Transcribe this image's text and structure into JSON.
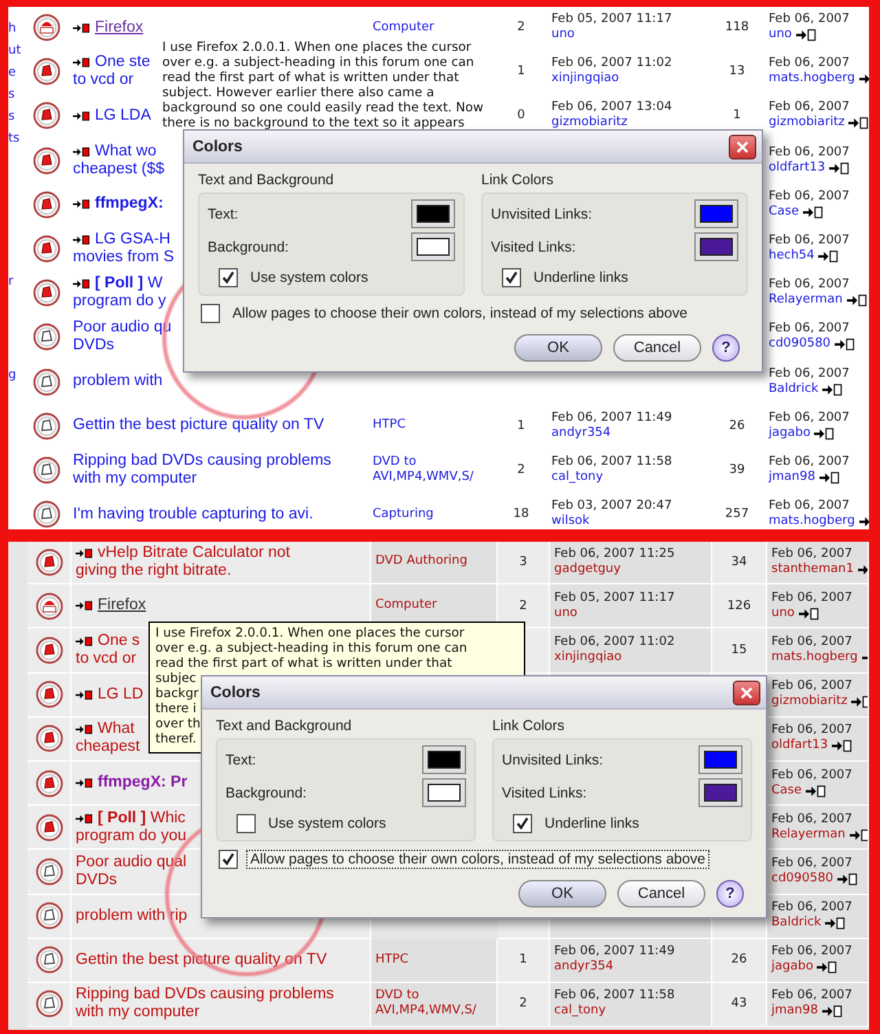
{
  "panels": [
    {
      "kind": "plain",
      "sidebar_fragments": [
        "h",
        "ut",
        "e",
        "s",
        "s",
        "ts",
        "r",
        "g"
      ],
      "rows": [
        {
          "kind": "me",
          "title": "Firefox",
          "visited": true,
          "hovered": true,
          "category": "Computer",
          "replies": "2",
          "last_date": "Feb 05, 2007 11:17",
          "last_name": "uno",
          "views": "118",
          "post_date": "Feb 06, 2007",
          "post_name": "uno"
        },
        {
          "kind": "hot",
          "title": "One ste\nto vcd or",
          "visited": false,
          "hovered": false,
          "replies": "1",
          "last_date": "Feb 06, 2007 11:02",
          "last_name": "xinjingqiao",
          "views": "13",
          "post_date": "Feb 06, 2007",
          "post_name": "mats.hogberg"
        },
        {
          "kind": "hot",
          "title": "LG LDA",
          "visited": false,
          "hovered": false,
          "replies": "0",
          "last_date": "Feb 06, 2007 13:04",
          "last_name": "gizmobiaritz",
          "views": "1",
          "post_date": "Feb 06, 2007",
          "post_name": "gizmobiaritz"
        },
        {
          "kind": "hot",
          "title": "What wo\ncheapest ($$",
          "visited": false,
          "hovered": false,
          "post_date": "Feb 06, 2007",
          "post_name": "oldfart13"
        },
        {
          "kind": "hot",
          "title": "**ffmpegX:**",
          "visited": false,
          "hovered": false,
          "post_date": "Feb 06, 2007",
          "post_name": "Case"
        },
        {
          "kind": "hot",
          "title": "LG GSA-H\nmovies from S",
          "visited": false,
          "hovered": false,
          "post_date": "Feb 06, 2007",
          "post_name": "hech54"
        },
        {
          "kind": "hot",
          "title": "**[ Poll ]** W\nprogram do y",
          "visited": false,
          "hovered": false,
          "post_date": "Feb 06, 2007",
          "post_name": "Relayerman"
        },
        {
          "kind": "plain",
          "title": "Poor audio qu\nDVDs",
          "visited": false,
          "hovered": false,
          "post_date": "Feb 06, 2007",
          "post_name": "cd090580"
        },
        {
          "kind": "plain",
          "title": "problem with",
          "visited": false,
          "hovered": false,
          "post_date": "Feb 06, 2007",
          "post_name": "Baldrick"
        },
        {
          "kind": "plain",
          "title": "Gettin the best picture quality on TV",
          "visited": false,
          "hovered": false,
          "category": "HTPC",
          "replies": "1",
          "last_date": "Feb 06, 2007 11:49",
          "last_name": "andyr354",
          "views": "26",
          "post_date": "Feb 06, 2007",
          "post_name": "jagabo"
        },
        {
          "kind": "plain",
          "title": "Ripping bad DVDs causing problems\nwith my computer",
          "visited": false,
          "hovered": false,
          "category": "DVD to AVI,MP4,WMV,S/",
          "replies": "2",
          "last_date": "Feb 06, 2007 11:58",
          "last_name": "cal_tony",
          "views": "39",
          "post_date": "Feb 06, 2007",
          "post_name": "jman98"
        },
        {
          "kind": "plain",
          "title": "I'm having trouble capturing to avi.",
          "visited": false,
          "hovered": false,
          "category": "Capturing",
          "replies": "18",
          "last_date": "Feb 03, 2007 20:47",
          "last_name": "wilsok",
          "views": "257",
          "post_date": "Feb 06, 2007",
          "post_name": "mats.hogberg"
        }
      ],
      "tooltip": {
        "kind": "bare",
        "lines": [
          "I use Firefox 2.0.0.1. When one places the cursor",
          "over e.g. a subject-heading in this forum one can",
          "read the first part of what is written under that",
          "subject. However earlier there also came a",
          "background so one could easily read the text. Now",
          "there is no background to the text so it appears"
        ]
      },
      "dialog": {
        "title": "Colors",
        "groups": [
          {
            "title": "Text and Background",
            "swatches": [
              {
                "label": "Text:",
                "color": "#000000"
              },
              {
                "label": "Background:",
                "color": "#ffffff"
              }
            ],
            "checkbox": {
              "label": "Use system colors",
              "checked": true
            }
          },
          {
            "title": "Link Colors",
            "swatches": [
              {
                "label": "Unvisited Links:",
                "color": "#0000ff"
              },
              {
                "label": "Visited Links:",
                "color": "#4b1a9a"
              }
            ],
            "checkbox": {
              "label": "Underline links",
              "checked": true
            }
          }
        ],
        "allow": {
          "label": "Allow pages to choose their own colors, instead of my selections above",
          "checked": false,
          "focused": false
        },
        "buttons": [
          "OK",
          "Cancel"
        ],
        "help": "?"
      }
    },
    {
      "kind": "shaded",
      "rows": [
        {
          "kind": "hot",
          "title": "vHelp Bitrate Calculator not\ngiving the right bitrate.",
          "visited": false,
          "hovered": false,
          "category": "DVD Authoring",
          "replies": "3",
          "last_date": "Feb 06, 2007 11:25",
          "last_name": "gadgetguy",
          "views": "34",
          "post_date": "Feb 06, 2007",
          "post_name": "stantheman1"
        },
        {
          "kind": "me",
          "title": "Firefox",
          "visited": false,
          "hovered": true,
          "category": "Computer",
          "replies": "2",
          "last_date": "Feb 05, 2007 11:17",
          "last_name": "uno",
          "views": "126",
          "post_date": "Feb 06, 2007",
          "post_name": "uno"
        },
        {
          "kind": "hot",
          "title": "One s\nto vcd or",
          "visited": false,
          "hovered": false,
          "last_date": "Feb 06, 2007 11:02",
          "last_name": "xinjingqiao",
          "views": "15",
          "post_date": "Feb 06, 2007",
          "post_name": "mats.hogberg"
        },
        {
          "kind": "hot",
          "title": "LG LD",
          "visited": false,
          "hovered": false,
          "post_date": "Feb 06, 2007",
          "post_name": "gizmobiaritz"
        },
        {
          "kind": "hot",
          "title": "What\ncheapest",
          "visited": false,
          "hovered": false,
          "post_date": "Feb 06, 2007",
          "post_name": "oldfart13"
        },
        {
          "kind": "hot",
          "title": "ffmpegX: Pr",
          "visited": true,
          "hovered": false,
          "post_date": "Feb 06, 2007",
          "post_name": "Case"
        },
        {
          "kind": "hot",
          "title": "**[ Poll ]** Whic\nprogram do you",
          "visited": false,
          "hovered": false,
          "post_date": "Feb 06, 2007",
          "post_name": "Relayerman"
        },
        {
          "kind": "plain",
          "title": "Poor audio qual\nDVDs",
          "visited": false,
          "hovered": false,
          "post_date": "Feb 06, 2007",
          "post_name": "cd090580"
        },
        {
          "kind": "plain",
          "title": "problem with rip",
          "visited": false,
          "hovered": false,
          "post_date": "Feb 06, 2007",
          "post_name": "Baldrick"
        },
        {
          "kind": "plain",
          "title": "Gettin the best picture quality on TV",
          "visited": false,
          "hovered": false,
          "category": "HTPC",
          "replies": "1",
          "last_date": "Feb 06, 2007 11:49",
          "last_name": "andyr354",
          "views": "26",
          "post_date": "Feb 06, 2007",
          "post_name": "jagabo"
        },
        {
          "kind": "plain",
          "title": "Ripping bad DVDs causing problems\nwith my computer",
          "visited": false,
          "hovered": false,
          "category": "DVD to AVI,MP4,WMV,S/",
          "replies": "2",
          "last_date": "Feb 06, 2007 11:58",
          "last_name": "cal_tony",
          "views": "43",
          "post_date": "Feb 06, 2007",
          "post_name": "jman98"
        }
      ],
      "tooltip": {
        "kind": "boxed",
        "lines": [
          "I use Firefox 2.0.0.1. When one places the cursor",
          "over e.g. a subject-heading in this forum one can",
          "read the first part of what is written under that",
          "subjec",
          "backgr",
          "there i",
          "over th",
          "theref."
        ]
      },
      "dialog": {
        "title": "Colors",
        "groups": [
          {
            "title": "Text and Background",
            "swatches": [
              {
                "label": "Text:",
                "color": "#000000"
              },
              {
                "label": "Background:",
                "color": "#ffffff"
              }
            ],
            "checkbox": {
              "label": "Use system colors",
              "checked": false
            }
          },
          {
            "title": "Link Colors",
            "swatches": [
              {
                "label": "Unvisited Links:",
                "color": "#0000ff"
              },
              {
                "label": "Visited Links:",
                "color": "#4b1a9a"
              }
            ],
            "checkbox": {
              "label": "Underline links",
              "checked": true
            }
          }
        ],
        "allow": {
          "label": "Allow pages to choose their own colors, instead of my selections above",
          "checked": true,
          "focused": true
        },
        "buttons": [
          "OK",
          "Cancel"
        ],
        "help": "?"
      }
    }
  ]
}
